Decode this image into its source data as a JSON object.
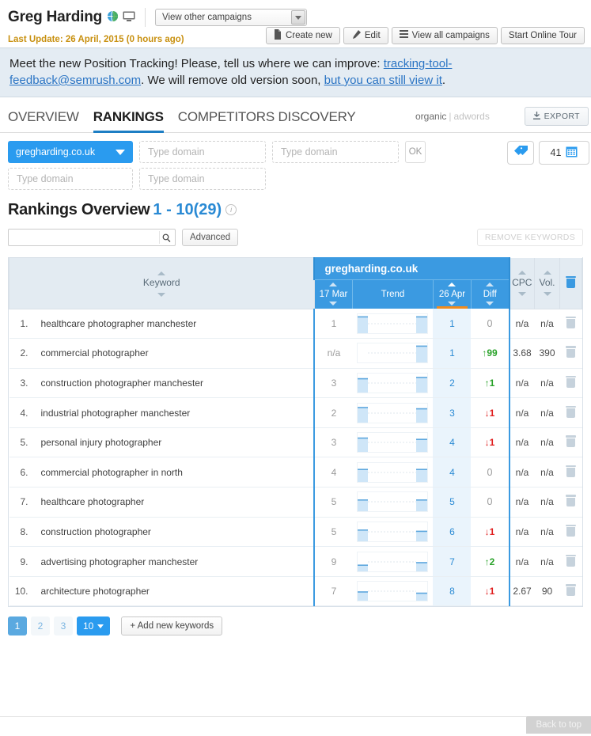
{
  "header": {
    "campaign_name": "Greg Harding",
    "globe_icon": "globe-icon",
    "device_icon": "desktop-monitor-icon",
    "campaign_select_value": "View other campaigns",
    "last_update": "Last Update: 26 April, 2015 (0 hours ago)",
    "buttons": [
      {
        "label": "Create new",
        "icon": "page-icon"
      },
      {
        "label": "Edit",
        "icon": "pencil-icon"
      },
      {
        "label": "View all campaigns",
        "icon": "list-icon"
      },
      {
        "label": "Start Online Tour",
        "icon": ""
      }
    ]
  },
  "notice": {
    "part1": "Meet the new Position Tracking! Please, tell us where we can improve: ",
    "link_email": "tracking-tool-feedback@semrush.com",
    "part2": ". We will remove old version soon, ",
    "link_view": "but you can still view it",
    "part3": "."
  },
  "tabs": {
    "items": [
      {
        "label": "OVERVIEW",
        "active": false
      },
      {
        "label": "RANKINGS",
        "active": true
      },
      {
        "label": "COMPETITORS DISCOVERY",
        "active": false
      }
    ],
    "mode_selected": "organic",
    "mode_separator": "|",
    "mode_other": "adwords",
    "export_label": "EXPORT",
    "export_icon": "download-icon"
  },
  "filters": {
    "primary_domain": "gregharding.co.uk",
    "domain_placeholder": "Type domain",
    "ok_label": "OK",
    "tag_icon": "tag-icon",
    "date_count": "41",
    "calendar_icon": "calendar-icon",
    "inputs_row1": [
      "Type domain",
      "Type domain"
    ],
    "inputs_row2": [
      "Type domain",
      "Type domain"
    ]
  },
  "rankings": {
    "title": "Rankings Overview",
    "range": "1 - 10(29)",
    "info_icon": "info-icon",
    "search_value": "",
    "search_placeholder": "",
    "search_icon": "search-icon",
    "advanced_label": "Advanced",
    "remove_keywords_label": "REMOVE KEYWORDS"
  },
  "table": {
    "col_keyword": "Keyword",
    "group_domain": "gregharding.co.uk",
    "col_old_date": "17 Mar",
    "col_trend": "Trend",
    "col_current_date": "26 Apr",
    "col_diff": "Diff",
    "col_cpc": "CPC",
    "col_vol": "Vol.",
    "col_delete_icon": "trash-icon",
    "rows": [
      {
        "num": "1.",
        "keyword": "healthcare photographer manchester",
        "old": "1",
        "current": "1",
        "diff": "0",
        "dir": "none",
        "cpc": "n/a",
        "vol": "n/a"
      },
      {
        "num": "2.",
        "keyword": "commercial photographer",
        "old": "n/a",
        "current": "1",
        "diff": "99",
        "dir": "up",
        "cpc": "3.68",
        "vol": "390"
      },
      {
        "num": "3.",
        "keyword": "construction photographer manchester",
        "old": "3",
        "current": "2",
        "diff": "1",
        "dir": "up",
        "cpc": "n/a",
        "vol": "n/a"
      },
      {
        "num": "4.",
        "keyword": "industrial photographer manchester",
        "old": "2",
        "current": "3",
        "diff": "1",
        "dir": "down",
        "cpc": "n/a",
        "vol": "n/a"
      },
      {
        "num": "5.",
        "keyword": "personal injury photographer",
        "old": "3",
        "current": "4",
        "diff": "1",
        "dir": "down",
        "cpc": "n/a",
        "vol": "n/a"
      },
      {
        "num": "6.",
        "keyword": "commercial photographer in north",
        "old": "4",
        "current": "4",
        "diff": "0",
        "dir": "none",
        "cpc": "n/a",
        "vol": "n/a"
      },
      {
        "num": "7.",
        "keyword": "healthcare photographer",
        "old": "5",
        "current": "5",
        "diff": "0",
        "dir": "none",
        "cpc": "n/a",
        "vol": "n/a"
      },
      {
        "num": "8.",
        "keyword": "construction photographer",
        "old": "5",
        "current": "6",
        "diff": "1",
        "dir": "down",
        "cpc": "n/a",
        "vol": "n/a"
      },
      {
        "num": "9.",
        "keyword": "advertising photographer manchester",
        "old": "9",
        "current": "7",
        "diff": "2",
        "dir": "up",
        "cpc": "n/a",
        "vol": "n/a"
      },
      {
        "num": "10.",
        "keyword": "architecture photographer",
        "old": "7",
        "current": "8",
        "diff": "1",
        "dir": "down",
        "cpc": "2.67",
        "vol": "90"
      }
    ]
  },
  "pagination": {
    "pages": [
      "1",
      "2",
      "3"
    ],
    "active_page": "1",
    "page_size": "10",
    "add_keywords_label": "+ Add new keywords"
  },
  "footer": {
    "back_to_top": "Back to top"
  },
  "colors": {
    "accent_blue": "#2a9bef",
    "header_blue": "#3b9ae1",
    "orange": "#f08b1e",
    "up_green": "#2aa22a",
    "down_red": "#e02020",
    "notice_bg": "#e4ecf3",
    "warn_gold": "#c8900f"
  }
}
